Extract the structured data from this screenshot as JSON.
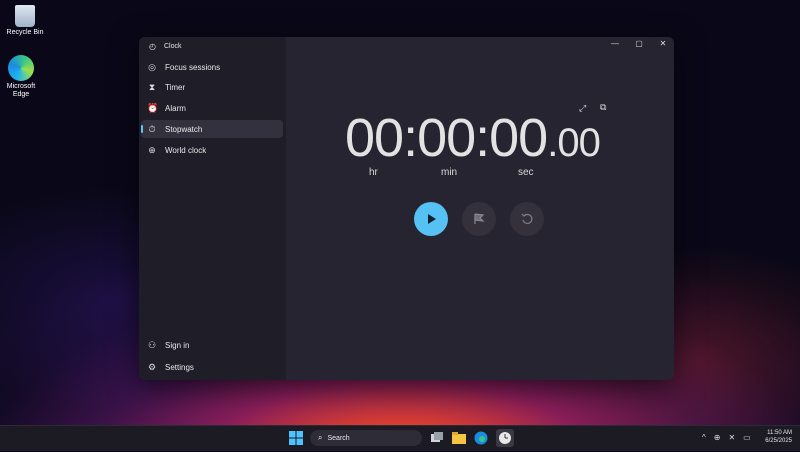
{
  "desktop": {
    "icons": [
      {
        "label": "Recycle Bin"
      },
      {
        "label": "Microsoft Edge"
      }
    ]
  },
  "window": {
    "app_title": "Clock",
    "nav": [
      {
        "label": "Focus sessions",
        "icon": "focus-icon"
      },
      {
        "label": "Timer",
        "icon": "timer-icon"
      },
      {
        "label": "Alarm",
        "icon": "alarm-icon"
      },
      {
        "label": "Stopwatch",
        "icon": "stopwatch-icon",
        "active": true
      },
      {
        "label": "World clock",
        "icon": "globe-icon"
      }
    ],
    "footer": [
      {
        "label": "Sign in",
        "icon": "person-icon"
      },
      {
        "label": "Settings",
        "icon": "gear-icon"
      }
    ]
  },
  "stopwatch": {
    "time_main": "00:00:00",
    "time_ms": ".00",
    "units": {
      "hr": "hr",
      "min": "min",
      "sec": "sec"
    }
  },
  "taskbar": {
    "search_label": "Search",
    "clock_time": "11:50 AM",
    "clock_date": "6/25/2025"
  },
  "colors": {
    "accent": "#56c2f3",
    "window_bg": "#272431",
    "sidebar_bg": "#1f1d27"
  }
}
